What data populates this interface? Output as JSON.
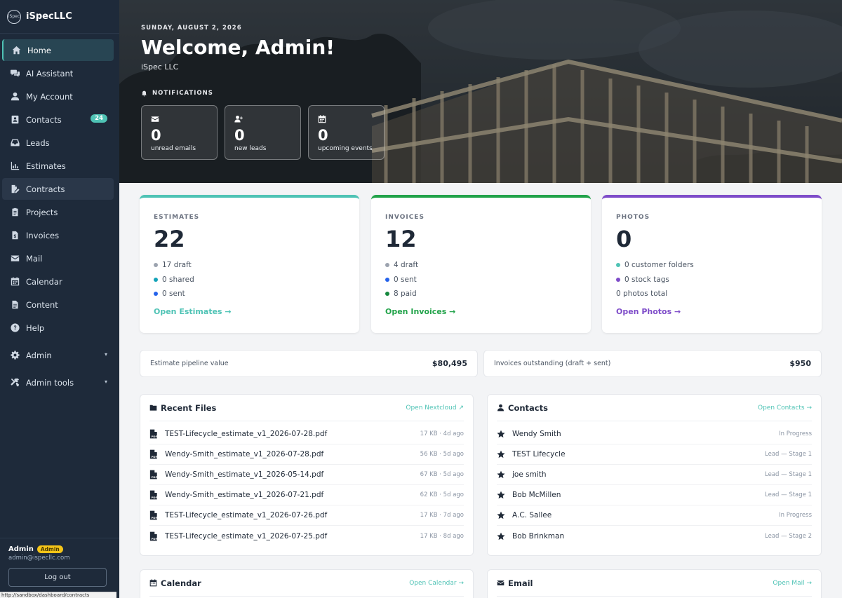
{
  "brand": {
    "logo_text": "iSpec",
    "name": "iSpecLLC"
  },
  "sidebar": {
    "items": [
      {
        "label": "Home",
        "icon": "home-icon"
      },
      {
        "label": "AI Assistant",
        "icon": "chat-icon"
      },
      {
        "label": "My Account",
        "icon": "user-icon"
      },
      {
        "label": "Contacts",
        "icon": "address-book-icon",
        "badge": "24"
      },
      {
        "label": "Leads",
        "icon": "inbox-icon"
      },
      {
        "label": "Estimates",
        "icon": "chart-icon"
      },
      {
        "label": "Contracts",
        "icon": "file-signature-icon"
      },
      {
        "label": "Projects",
        "icon": "clipboard-icon"
      },
      {
        "label": "Invoices",
        "icon": "invoice-icon"
      },
      {
        "label": "Mail",
        "icon": "envelope-icon"
      },
      {
        "label": "Calendar",
        "icon": "calendar-icon"
      },
      {
        "label": "Content",
        "icon": "document-icon"
      },
      {
        "label": "Help",
        "icon": "help-icon"
      },
      {
        "label": "Admin",
        "icon": "gear-icon",
        "caret": "▾"
      },
      {
        "label": "Admin tools",
        "icon": "tools-icon",
        "caret": "▾"
      }
    ],
    "user": {
      "name": "Admin",
      "role_badge": "Admin",
      "email": "admin@ispecllc.com",
      "logout_label": "Log out"
    },
    "status_url": "http://sandbox/dashboard/contracts"
  },
  "hero": {
    "date": "SUNDAY, AUGUST 2, 2026",
    "title": "Welcome, Admin!",
    "subtitle": "iSpec LLC",
    "notifications_label": "NOTIFICATIONS",
    "cards": [
      {
        "icon": "envelope-icon",
        "value": "0",
        "label": "unread emails"
      },
      {
        "icon": "user-plus-icon",
        "value": "0",
        "label": "new leads"
      },
      {
        "icon": "calendar-icon",
        "value": "0",
        "label": "upcoming events"
      }
    ]
  },
  "stats": {
    "estimates": {
      "title": "ESTIMATES",
      "value": "22",
      "rows": [
        "17 draft",
        "0 shared",
        "0 sent"
      ],
      "link": "Open Estimates →",
      "accent": "#4fc3b5"
    },
    "invoices": {
      "title": "INVOICES",
      "value": "12",
      "rows": [
        "4 draft",
        "0 sent",
        "8 paid"
      ],
      "link": "Open Invoices →",
      "accent": "#22a34a"
    },
    "photos": {
      "title": "PHOTOS",
      "value": "0",
      "rows": [
        "0 customer folders",
        "0 stock tags",
        "0 photos total"
      ],
      "link": "Open Photos →",
      "accent": "#7e4cc9"
    }
  },
  "summary": {
    "pipeline": {
      "label": "Estimate pipeline value",
      "value": "$80,495"
    },
    "outstanding": {
      "label": "Invoices outstanding (draft + sent)",
      "value": "$950"
    }
  },
  "recent_files": {
    "title": "Recent Files",
    "link": "Open Nextcloud ↗",
    "files": [
      {
        "name": "TEST-Lifecycle_estimate_v1_2026-07-28.pdf",
        "meta": "17 KB · 4d ago"
      },
      {
        "name": "Wendy-Smith_estimate_v1_2026-07-28.pdf",
        "meta": "56 KB · 5d ago"
      },
      {
        "name": "Wendy-Smith_estimate_v1_2026-05-14.pdf",
        "meta": "67 KB · 5d ago"
      },
      {
        "name": "Wendy-Smith_estimate_v1_2026-07-21.pdf",
        "meta": "62 KB · 5d ago"
      },
      {
        "name": "TEST-Lifecycle_estimate_v1_2026-07-26.pdf",
        "meta": "17 KB · 7d ago"
      },
      {
        "name": "TEST-Lifecycle_estimate_v1_2026-07-25.pdf",
        "meta": "17 KB · 8d ago"
      }
    ]
  },
  "contacts": {
    "title": "Contacts",
    "link": "Open Contacts →",
    "items": [
      {
        "name": "Wendy Smith",
        "status": "In Progress"
      },
      {
        "name": "TEST Lifecycle",
        "status": "Lead — Stage 1"
      },
      {
        "name": "joe smith",
        "status": "Lead — Stage 1"
      },
      {
        "name": "Bob McMillen",
        "status": "Lead — Stage 1"
      },
      {
        "name": "A.C. Sallee",
        "status": "In Progress"
      },
      {
        "name": "Bob Brinkman",
        "status": "Lead — Stage 2"
      }
    ]
  },
  "calendar_panel": {
    "title": "Calendar",
    "link": "Open Calendar →"
  },
  "email_panel": {
    "title": "Email",
    "link": "Open Mail →"
  },
  "colors": {
    "sidebar_bg": "#1e2a3a",
    "accent_teal": "#4fc3b5",
    "green": "#22a34a",
    "purple": "#7e4cc9",
    "blue": "#2563eb",
    "gray_dot": "#9ca3af"
  }
}
